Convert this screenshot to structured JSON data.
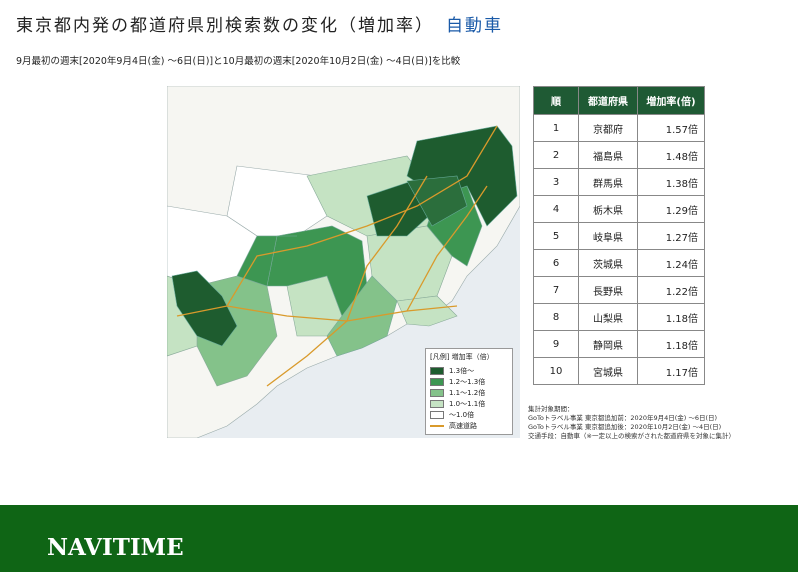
{
  "header": {
    "title": "東京都内発の都道府県別検索数の変化（増加率）",
    "title_sub": "自動車",
    "subtitle": "9月最初の週末[2020年9月4日(金) ～6日(日)]と10月最初の週末[2020年10月2日(金) ～4日(日)]を比較"
  },
  "legend": {
    "header": "[凡例] 増加率（倍）",
    "items": [
      {
        "label": "1.3倍～",
        "color": "#1e5c2f"
      },
      {
        "label": "1.2～1.3倍",
        "color": "#3d9652"
      },
      {
        "label": "1.1～1.2倍",
        "color": "#84c28a"
      },
      {
        "label": "1.0～1.1倍",
        "color": "#c5e3c3"
      },
      {
        "label": "～1.0倍",
        "color": "#ffffff"
      }
    ],
    "road_label": "高速道路",
    "road_color": "#d99a2b"
  },
  "ranking": {
    "headers": [
      "順",
      "都道府県",
      "増加率(倍)"
    ],
    "rows": [
      {
        "rank": "1",
        "pref": "京都府",
        "rate": "1.57倍"
      },
      {
        "rank": "2",
        "pref": "福島県",
        "rate": "1.48倍"
      },
      {
        "rank": "3",
        "pref": "群馬県",
        "rate": "1.38倍"
      },
      {
        "rank": "4",
        "pref": "栃木県",
        "rate": "1.29倍"
      },
      {
        "rank": "5",
        "pref": "岐阜県",
        "rate": "1.27倍"
      },
      {
        "rank": "6",
        "pref": "茨城県",
        "rate": "1.24倍"
      },
      {
        "rank": "7",
        "pref": "長野県",
        "rate": "1.22倍"
      },
      {
        "rank": "8",
        "pref": "山梨県",
        "rate": "1.18倍"
      },
      {
        "rank": "9",
        "pref": "静岡県",
        "rate": "1.18倍"
      },
      {
        "rank": "10",
        "pref": "宮城県",
        "rate": "1.17倍"
      }
    ]
  },
  "notes": [
    "集計対象期間：",
    "GoToトラベル事業 東京都追加前：2020年9月4日(金) ～6日(日)",
    "GoToトラベル事業 東京都追加後：2020年10月2日(金) ～4日(日)",
    "交通手段：自動車（※一定以上の検索がされた都道府県を対象に集計）"
  ],
  "footer": {
    "logo": "NAVITIME",
    "color": "#0f6515"
  }
}
